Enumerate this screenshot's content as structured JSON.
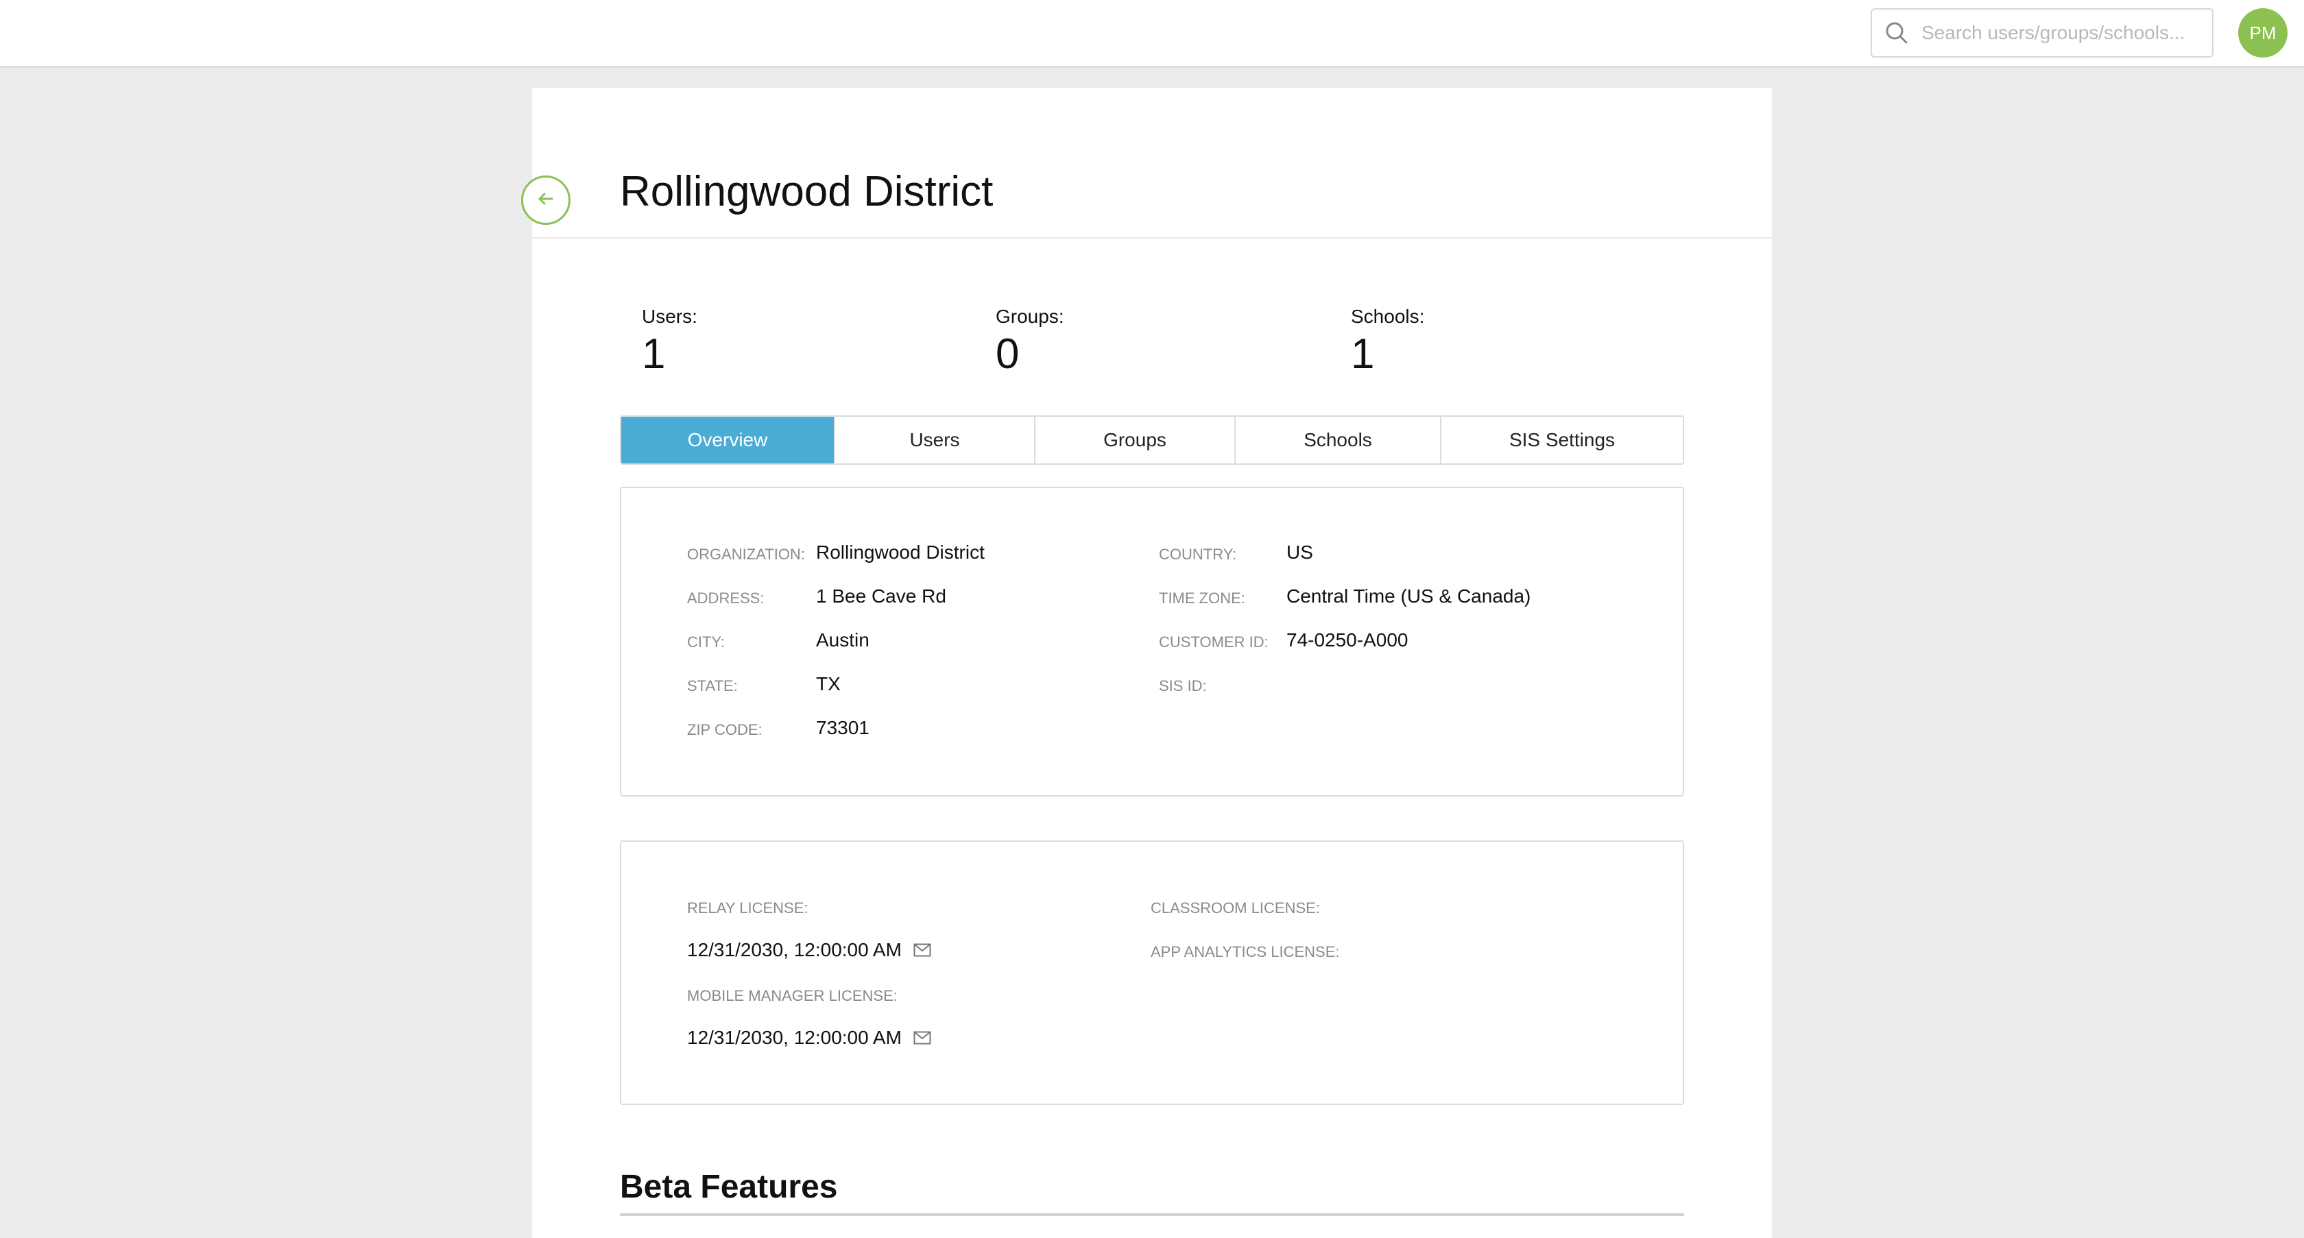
{
  "header": {
    "search_placeholder": "Search users/groups/schools...",
    "avatar_initials": "PM"
  },
  "page": {
    "title": "Rollingwood District"
  },
  "stats": [
    {
      "label": "Users:",
      "value": "1"
    },
    {
      "label": "Groups:",
      "value": "0"
    },
    {
      "label": "Schools:",
      "value": "1"
    }
  ],
  "tabs": [
    {
      "label": "Overview",
      "active": true
    },
    {
      "label": "Users",
      "active": false
    },
    {
      "label": "Groups",
      "active": false
    },
    {
      "label": "Schools",
      "active": false
    },
    {
      "label": "SIS Settings",
      "active": false
    }
  ],
  "overview": {
    "left": [
      {
        "label": "ORGANIZATION:",
        "value": "Rollingwood District"
      },
      {
        "label": "ADDRESS:",
        "value": "1 Bee Cave Rd"
      },
      {
        "label": "CITY:",
        "value": "Austin"
      },
      {
        "label": "STATE:",
        "value": "TX"
      },
      {
        "label": "ZIP CODE:",
        "value": "73301"
      }
    ],
    "right": [
      {
        "label": "COUNTRY:",
        "value": "US"
      },
      {
        "label": "TIME ZONE:",
        "value": "Central Time (US & Canada)"
      },
      {
        "label": "CUSTOMER ID:",
        "value": "74-0250-A000"
      },
      {
        "label": "SIS ID:",
        "value": ""
      }
    ]
  },
  "licenses": {
    "relay_label": "RELAY LICENSE:",
    "relay_value": "12/31/2030, 12:00:00 AM",
    "mobile_manager_label": "MOBILE MANAGER LICENSE:",
    "mobile_manager_value": "12/31/2030, 12:00:00 AM",
    "classroom_label": "CLASSROOM LICENSE:",
    "app_analytics_label": "APP ANALYTICS LICENSE:"
  },
  "beta": {
    "title": "Beta Features"
  },
  "colors": {
    "accent_green": "#8cc152",
    "tab_active_blue": "#4bacd6"
  },
  "icons": [
    "search-icon",
    "back-arrow-icon",
    "mail-icon"
  ]
}
